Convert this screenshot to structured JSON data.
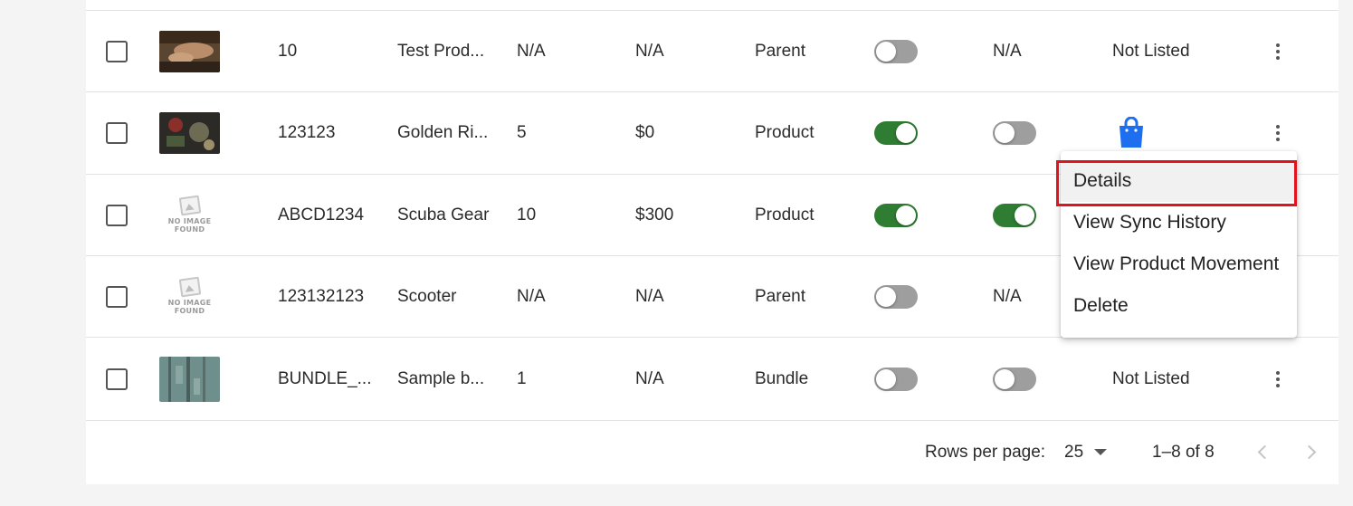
{
  "rows": [
    {
      "sku": "10",
      "name": "Test Prod...",
      "qty": "N/A",
      "price": "N/A",
      "type": "Parent",
      "status": "Not Listed",
      "ext": "N/A"
    },
    {
      "sku": "123123",
      "name": "Golden Ri...",
      "qty": "5",
      "price": "$0",
      "type": "Product",
      "status": "",
      "ext": ""
    },
    {
      "sku": "ABCD1234",
      "name": "Scuba Gear",
      "qty": "10",
      "price": "$300",
      "type": "Product",
      "status": "",
      "ext": ""
    },
    {
      "sku": "123132123",
      "name": "Scooter",
      "qty": "N/A",
      "price": "N/A",
      "type": "Parent",
      "status": "",
      "ext": "N/A"
    },
    {
      "sku": "BUNDLE_...",
      "name": "Sample b...",
      "qty": "1",
      "price": "N/A",
      "type": "Bundle",
      "status": "Not Listed",
      "ext": ""
    }
  ],
  "no_image": {
    "line1": "NO IMAGE",
    "line2": "FOUND"
  },
  "menu": {
    "details": "Details",
    "sync": "View Sync History",
    "movement": "View Product Movement",
    "delete": "Delete"
  },
  "pagination": {
    "rows_label": "Rows per page:",
    "rows_value": "25",
    "range": "1–8 of 8"
  },
  "colors": {
    "toggle_on": "#2e7d32",
    "toggle_off": "#9e9e9e",
    "shop_icon": "#1e6ff0",
    "highlight": "#e0141e"
  }
}
